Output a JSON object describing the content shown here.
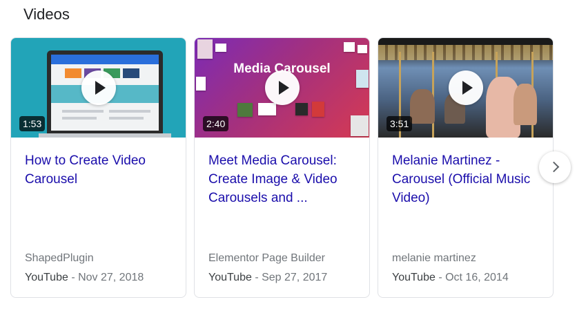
{
  "section": {
    "title": "Videos"
  },
  "videos": [
    {
      "title": "How to Create Video Carousel",
      "duration": "1:53",
      "channel": "ShapedPlugin",
      "source": "YouTube",
      "separator": " - ",
      "date": "Nov 27, 2018",
      "thumb_color": "#22a4b8"
    },
    {
      "title": "Meet Media Carousel: Create Image & Video Carousels and ...",
      "duration": "2:40",
      "channel": "Elementor Page Builder",
      "source": "YouTube",
      "separator": " - ",
      "date": "Sep 27, 2017",
      "thumb_text": "Media Carousel",
      "thumb_color": "#a3307f"
    },
    {
      "title": "Melanie Martinez - Carousel (Official Music Video)",
      "duration": "3:51",
      "channel": "melanie martinez",
      "source": "YouTube",
      "separator": " - ",
      "date": "Oct 16, 2014",
      "thumb_color": "#4b6382"
    }
  ],
  "colors": {
    "link": "#1a0dab",
    "meta": "#70757a",
    "border": "#dfe1e5"
  },
  "icons": {
    "play": "play-icon",
    "next": "chevron-right-icon"
  }
}
